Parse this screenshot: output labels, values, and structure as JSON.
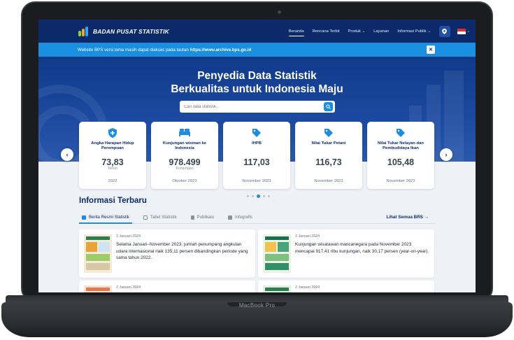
{
  "device": {
    "label": "MacBook Pro"
  },
  "navbar": {
    "brand": "BADAN PUSAT STATISTIK",
    "items": [
      {
        "label": "Beranda",
        "active": true,
        "dropdown": false
      },
      {
        "label": "Rencana Terbit",
        "active": false,
        "dropdown": false
      },
      {
        "label": "Produk",
        "active": false,
        "dropdown": true
      },
      {
        "label": "Layanan",
        "active": false,
        "dropdown": false
      },
      {
        "label": "Informasi Publik",
        "active": false,
        "dropdown": true
      }
    ]
  },
  "banner": {
    "text": "Website BPS versi lama masih dapat diakses pada tautan",
    "link": "https://www.archive.bps.go.id"
  },
  "hero": {
    "title_line1": "Penyedia Data Statistik",
    "title_line2": "Berkualitas untuk Indonesia Maju",
    "search_placeholder": "Cari data statistik..."
  },
  "indicators": [
    {
      "label": "Angka Harapan Hidup Perempuan",
      "value": "73,83",
      "unit": "Tahun",
      "period": "2022",
      "icon": "shield-plus-icon"
    },
    {
      "label": "Kunjungan wisman ke Indonesia",
      "value": "978.499",
      "unit": "Kunjungan",
      "period": "Oktober 2023",
      "icon": "bed-icon"
    },
    {
      "label": "IHPB",
      "value": "117,03",
      "unit": "",
      "period": "November 2023",
      "icon": "price-tag-icon"
    },
    {
      "label": "Nilai Tukar Petani",
      "value": "116,73",
      "unit": "",
      "period": "November 2023",
      "icon": "price-tag-icon"
    },
    {
      "label": "Nilai Tukar Nelayan dan Pembudidaya Ikan",
      "value": "105,48",
      "unit": "",
      "period": "November 2023",
      "icon": "price-tag-icon"
    }
  ],
  "info": {
    "title": "Informasi Terbaru",
    "tabs": [
      {
        "label": "Berita Resmi Statistik",
        "active": true
      },
      {
        "label": "Tabel Statistik",
        "active": false
      },
      {
        "label": "Publikasi",
        "active": false
      },
      {
        "label": "Infografis",
        "active": false
      }
    ],
    "see_all": "Lihat Semua BRS →",
    "news": [
      {
        "date": "2 Januari 2024",
        "text": "Selama Januari–November 2023, jumlah penumpang angkutan udara internasional naik 135,11 persen dibandingkan periode yang sama tahun 2022."
      },
      {
        "date": "2 Januari 2024",
        "text": "Kunjungan wisatawan mancanegara pada November 2023 mencapai 917,41 ribu kunjungan, naik 30,17 persen (year-on-year)."
      },
      {
        "date": "2 Januari 2024",
        "text": ""
      },
      {
        "date": "2 Januari 2024",
        "text": ""
      }
    ]
  },
  "colors": {
    "navy": "#0c2a6a",
    "accent": "#1a8ee0",
    "banner": "#1a8ee0"
  }
}
